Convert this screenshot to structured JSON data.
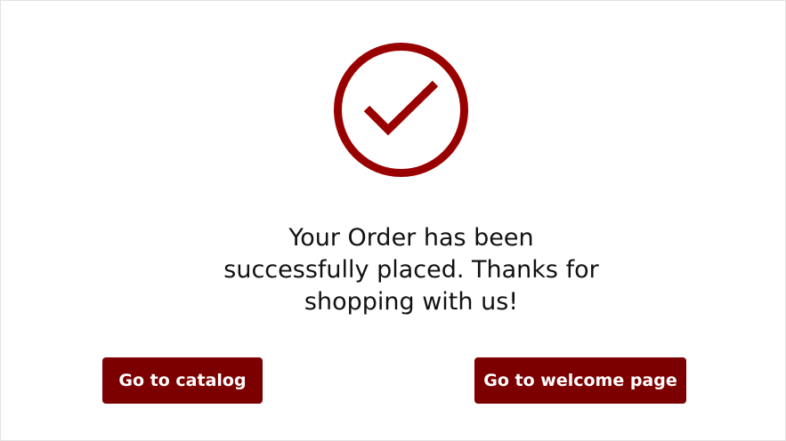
{
  "success": {
    "icon": "check-circle-icon",
    "message": "Your Order has been successfully placed. Thanks for shopping with us!"
  },
  "actions": {
    "catalog_label": "Go to catalog",
    "welcome_label": "Go to welcome page"
  },
  "colors": {
    "accent": "#990000",
    "button_background": "#7d0000",
    "button_text": "#ffffff",
    "message_text": "#111111",
    "page_background": "#ffffff"
  }
}
